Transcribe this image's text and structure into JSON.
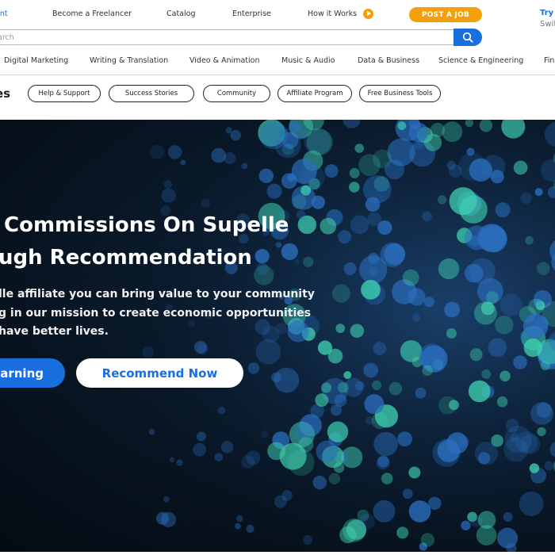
{
  "topnav": {
    "clipped_left": "ent",
    "freelancer": "Become a Freelancer",
    "catalog": "Catalog",
    "enterprise": "Enterprise",
    "how_it_works": "How it Works",
    "how_icon": "play-circle-icon",
    "post_job": "POST A JOB",
    "try": "Try",
    "swift": "Swif"
  },
  "search": {
    "placeholder": "arch",
    "button_icon": "search-icon"
  },
  "categories": [
    "Digital Marketing",
    "Writing & Translation",
    "Video & Animation",
    "Music & Audio",
    "Data & Business",
    "Science & Engineering",
    "Fina"
  ],
  "subnav": {
    "title": "es",
    "pills": [
      "Help & Support",
      "Success Stories",
      "Community",
      "Affiliate Program",
      "Free Business Tools"
    ]
  },
  "hero": {
    "headline_1": "Commissions On Supelle",
    "headline_2": "ugh Recommendation",
    "para_1": "lle affiliate you can bring value to your community",
    "para_2": "g in our mission to create economic opportunities",
    "para_3": "have better lives.",
    "start_button": "Earning",
    "recommend_button": "Recommend Now"
  },
  "colors": {
    "accent": "#1a6fe0",
    "orange": "#f4a00c",
    "hero_bg": "#07131f",
    "bokeh_teal": "#3fd0b0",
    "bokeh_blue": "#2b6fc0"
  }
}
